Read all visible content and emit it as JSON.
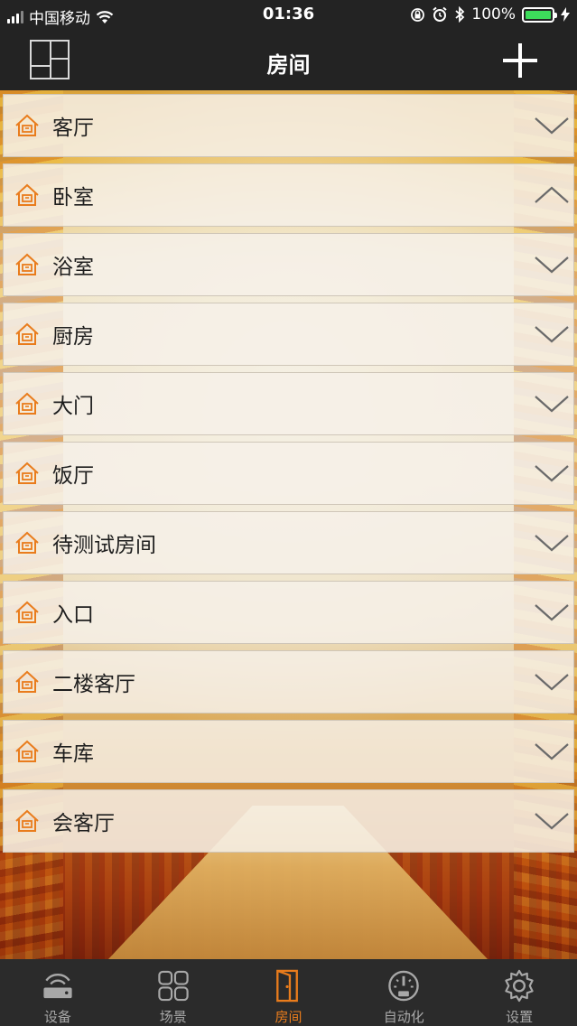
{
  "status_bar": {
    "carrier": "中国移动",
    "time": "01:36",
    "battery_percent": "100%"
  },
  "nav": {
    "title": "房间"
  },
  "rooms": [
    {
      "name": "客厅",
      "expanded": false
    },
    {
      "name": "卧室",
      "expanded": true
    },
    {
      "name": "浴室",
      "expanded": false
    },
    {
      "name": "厨房",
      "expanded": false
    },
    {
      "name": "大门",
      "expanded": false
    },
    {
      "name": "饭厅",
      "expanded": false
    },
    {
      "name": "待测试房间",
      "expanded": false
    },
    {
      "name": "入口",
      "expanded": false
    },
    {
      "name": "二楼客厅",
      "expanded": false
    },
    {
      "name": "车库",
      "expanded": false
    },
    {
      "name": "会客厅",
      "expanded": false
    }
  ],
  "tabs": [
    {
      "label": "设备",
      "icon": "router-icon",
      "active": false
    },
    {
      "label": "场景",
      "icon": "grid-icon",
      "active": false
    },
    {
      "label": "房间",
      "icon": "door-icon",
      "active": true
    },
    {
      "label": "自动化",
      "icon": "gauge-icon",
      "active": false
    },
    {
      "label": "设置",
      "icon": "gear-icon",
      "active": false
    }
  ],
  "colors": {
    "accent": "#e97c1c",
    "bar_background": "#232323",
    "tab_inactive": "#a8a8a8"
  }
}
